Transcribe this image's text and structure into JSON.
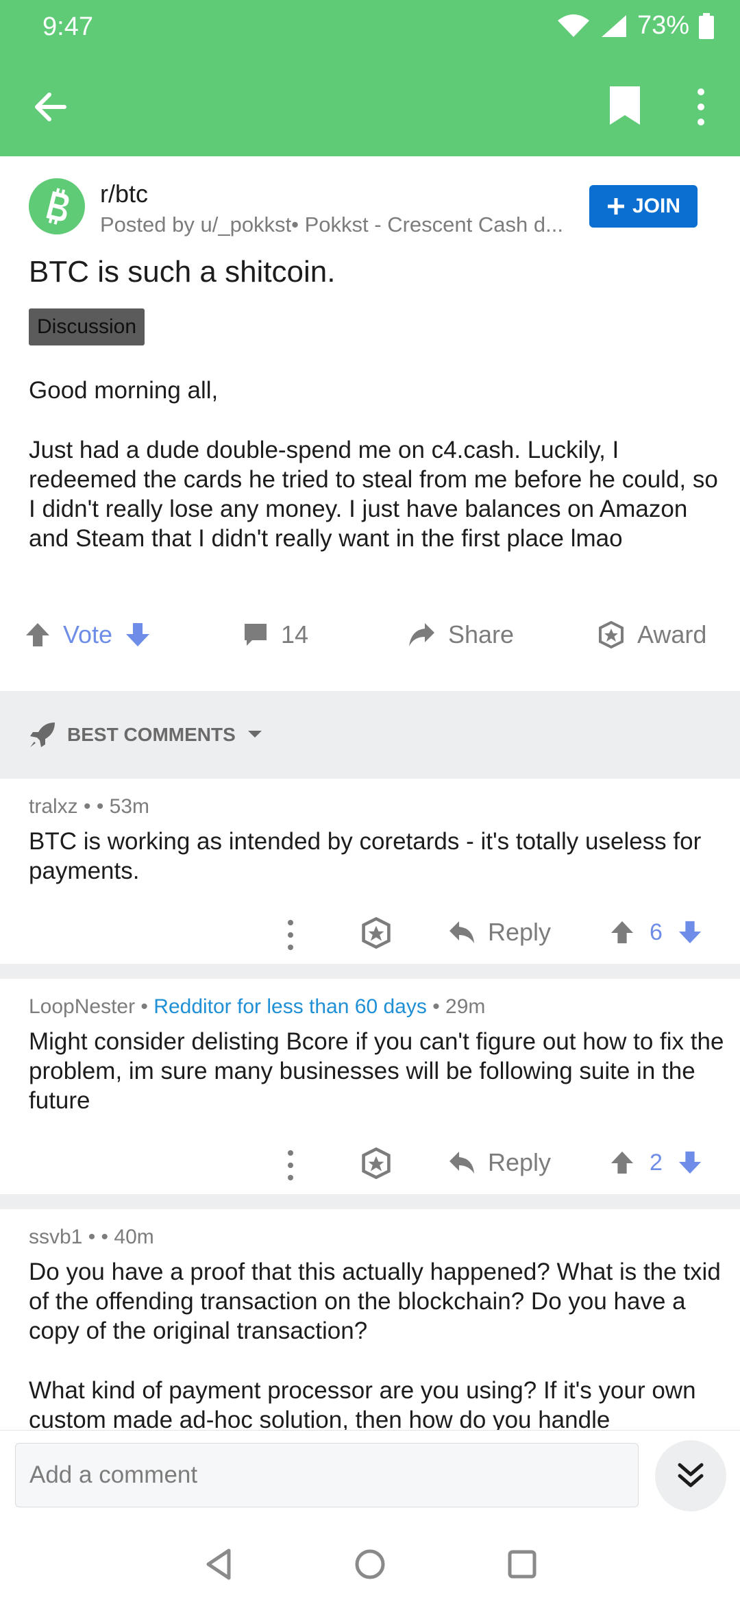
{
  "status_bar": {
    "time": "9:47",
    "battery": "73%"
  },
  "post": {
    "subreddit": "r/btc",
    "posted_by": "Posted by u/_pokkst• Pokkst - Crescent Cash d...",
    "join_label": "JOIN",
    "title": "BTC is such a shitcoin.",
    "flair": "Discussion",
    "body": [
      "Good morning all,",
      "Just had a dude double-spend me on c4.cash. Luckily, I redeemed the cards he tried to steal from me before he could, so I didn't really lose any money. I just have balances on Amazon and Steam that I didn't really want in the first place lmao"
    ],
    "actions": {
      "vote_label": "Vote",
      "comment_count": "14",
      "share_label": "Share",
      "award_label": "Award"
    }
  },
  "sort": {
    "label": "BEST COMMENTS"
  },
  "comments": [
    {
      "meta": "tralxz •  • 53m",
      "text": "BTC is working as intended by coretards - it's totally useless for payments.",
      "reply_label": "Reply",
      "score": "6"
    },
    {
      "meta_user": "LoopNester •",
      "meta_badge": "Redditor for less than 60 days",
      "meta_time": "• 29m",
      "text": "Might consider delisting Bcore if you can't figure out how to fix the problem, im sure many businesses will be following suite in the future",
      "reply_label": "Reply",
      "score": "2"
    },
    {
      "meta": "ssvb1 •  • 40m",
      "text_1": "Do you have a proof that this actually happened? What is the txid of the offending transaction on the blockchain? Do you have a copy of the original transaction?",
      "text_2": "What kind of payment processor are you using? If it's your own custom made ad-hoc solution, then how do you handle"
    }
  ],
  "comment_bar": {
    "placeholder": "Add a comment"
  },
  "colors": {
    "app_bar": "#5fcb77",
    "join": "#0a6fd1",
    "vote": "#6d8de8",
    "badge": "#1f8fd6"
  }
}
